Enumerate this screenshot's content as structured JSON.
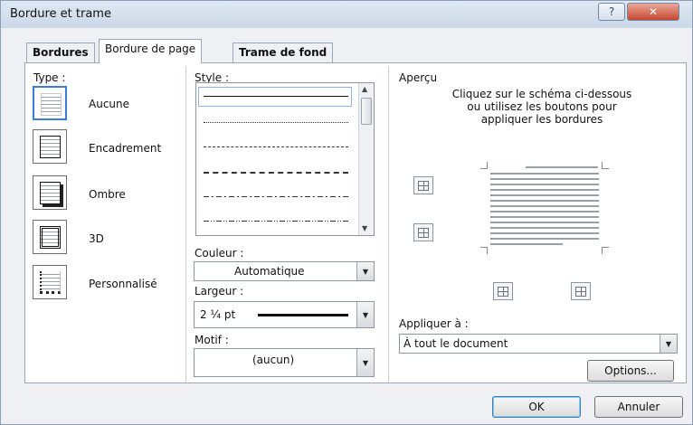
{
  "window": {
    "title": "Bordure et trame",
    "help_label": "?",
    "close_label": "✕"
  },
  "tabs": [
    {
      "label": "Bordures",
      "active": false
    },
    {
      "label": "Bordure de page",
      "active": true
    },
    {
      "label": "Trame de fond",
      "active": false
    }
  ],
  "type": {
    "label": "Type :",
    "options": [
      {
        "label": "Aucune",
        "icon": "page-none-icon"
      },
      {
        "label": "Encadrement",
        "icon": "page-box-icon"
      },
      {
        "label": "Ombre",
        "icon": "page-shadow-icon"
      },
      {
        "label": "3D",
        "icon": "page-3d-icon"
      },
      {
        "label": "Personnalisé",
        "icon": "page-custom-icon"
      }
    ],
    "selected": "Aucune"
  },
  "style": {
    "label": "Style :",
    "options": [
      "solid",
      "dotted-fine",
      "dashed-small",
      "dashed",
      "dash-dot",
      "dash-dot-dot"
    ]
  },
  "couleur": {
    "label": "Couleur :",
    "value": "Automatique"
  },
  "largeur": {
    "label": "Largeur :",
    "value": "2 ¼ pt"
  },
  "motif": {
    "label": "Motif :",
    "value": "(aucun)"
  },
  "apercu": {
    "label": "Aperçu",
    "instructions": "Cliquez sur le schéma ci-dessous ou utilisez les boutons pour appliquer les bordures"
  },
  "appliquer": {
    "label": "Appliquer à :",
    "value": "À tout le document"
  },
  "buttons": {
    "options": "Options...",
    "ok": "OK",
    "annuler": "Annuler"
  },
  "colors": {
    "accent": "#3b7dd8",
    "panel_bg": "#ffffff",
    "window_bg": "#eef0f3"
  }
}
